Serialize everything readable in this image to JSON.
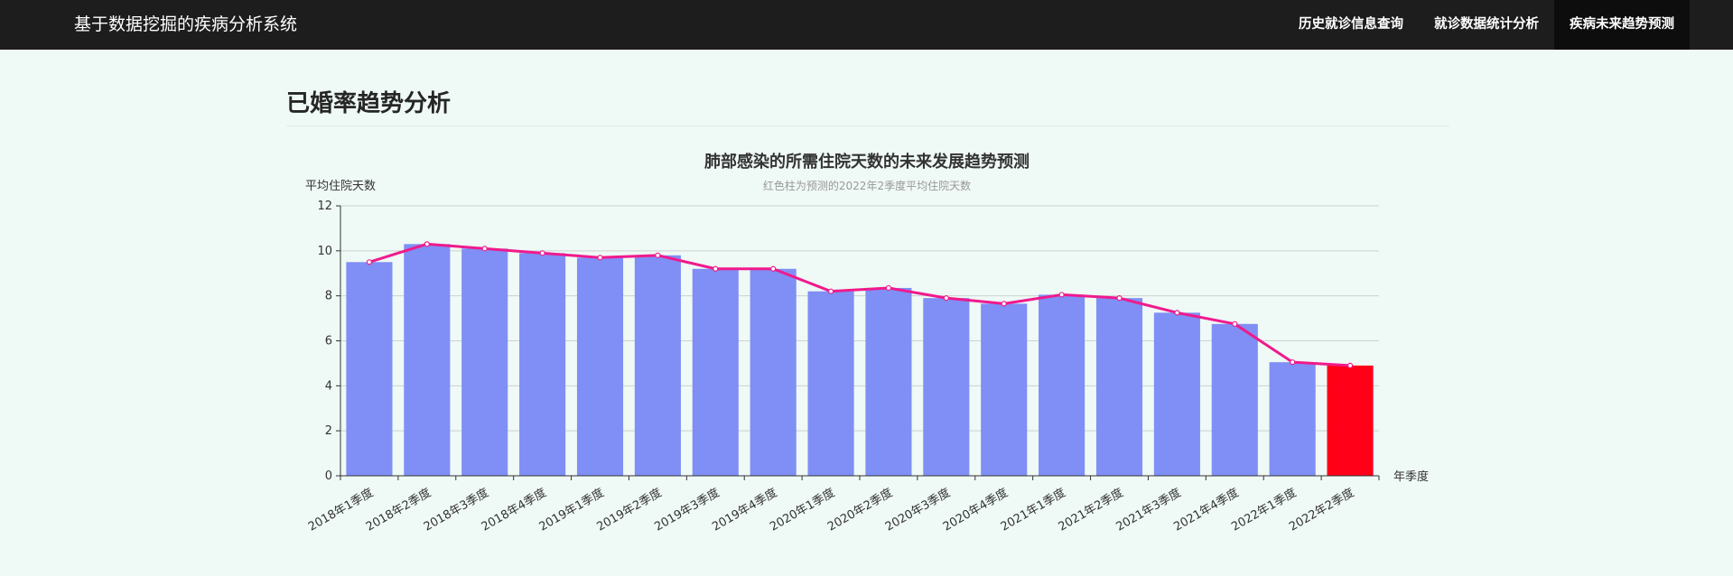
{
  "navbar": {
    "brand": "基于数据挖掘的疾病分析系统",
    "items": [
      {
        "label": "历史就诊信息查询",
        "active": false
      },
      {
        "label": "就诊数据统计分析",
        "active": false
      },
      {
        "label": "疾病未来趋势预测",
        "active": true
      }
    ]
  },
  "page": {
    "title": "已婚率趋势分析"
  },
  "colors": {
    "navbar_bg": "#1d1d1d",
    "page_bg": "#eff9f6",
    "bar": "#7f8ff5",
    "bar_predicted": "#ff0018",
    "line": "#f01a8c"
  },
  "chart_data": {
    "type": "bar",
    "title": "肺部感染的所需住院天数的未来发展趋势预测",
    "subtitle": "红色柱为预测的2022年2季度平均住院天数",
    "xlabel": "年季度",
    "ylabel": "平均住院天数",
    "ylim": [
      0,
      12
    ],
    "yticks": [
      0,
      2,
      4,
      6,
      8,
      10,
      12
    ],
    "grid": true,
    "categories": [
      "2018年1季度",
      "2018年2季度",
      "2018年3季度",
      "2018年4季度",
      "2019年1季度",
      "2019年2季度",
      "2019年3季度",
      "2019年4季度",
      "2020年1季度",
      "2020年2季度",
      "2020年3季度",
      "2020年4季度",
      "2021年1季度",
      "2021年2季度",
      "2021年3季度",
      "2021年4季度",
      "2022年1季度",
      "2022年2季度"
    ],
    "series": [
      {
        "type": "bar",
        "values": [
          9.5,
          10.3,
          10.1,
          9.9,
          9.7,
          9.8,
          9.2,
          9.2,
          8.2,
          8.35,
          7.9,
          7.65,
          8.05,
          7.9,
          7.25,
          6.75,
          5.05,
          4.9
        ]
      },
      {
        "type": "line",
        "values": [
          9.5,
          10.3,
          10.1,
          9.9,
          9.7,
          9.8,
          9.2,
          9.2,
          8.2,
          8.35,
          7.9,
          7.65,
          8.05,
          7.9,
          7.25,
          6.75,
          5.05,
          4.9
        ]
      }
    ],
    "predicted_index": 17
  }
}
